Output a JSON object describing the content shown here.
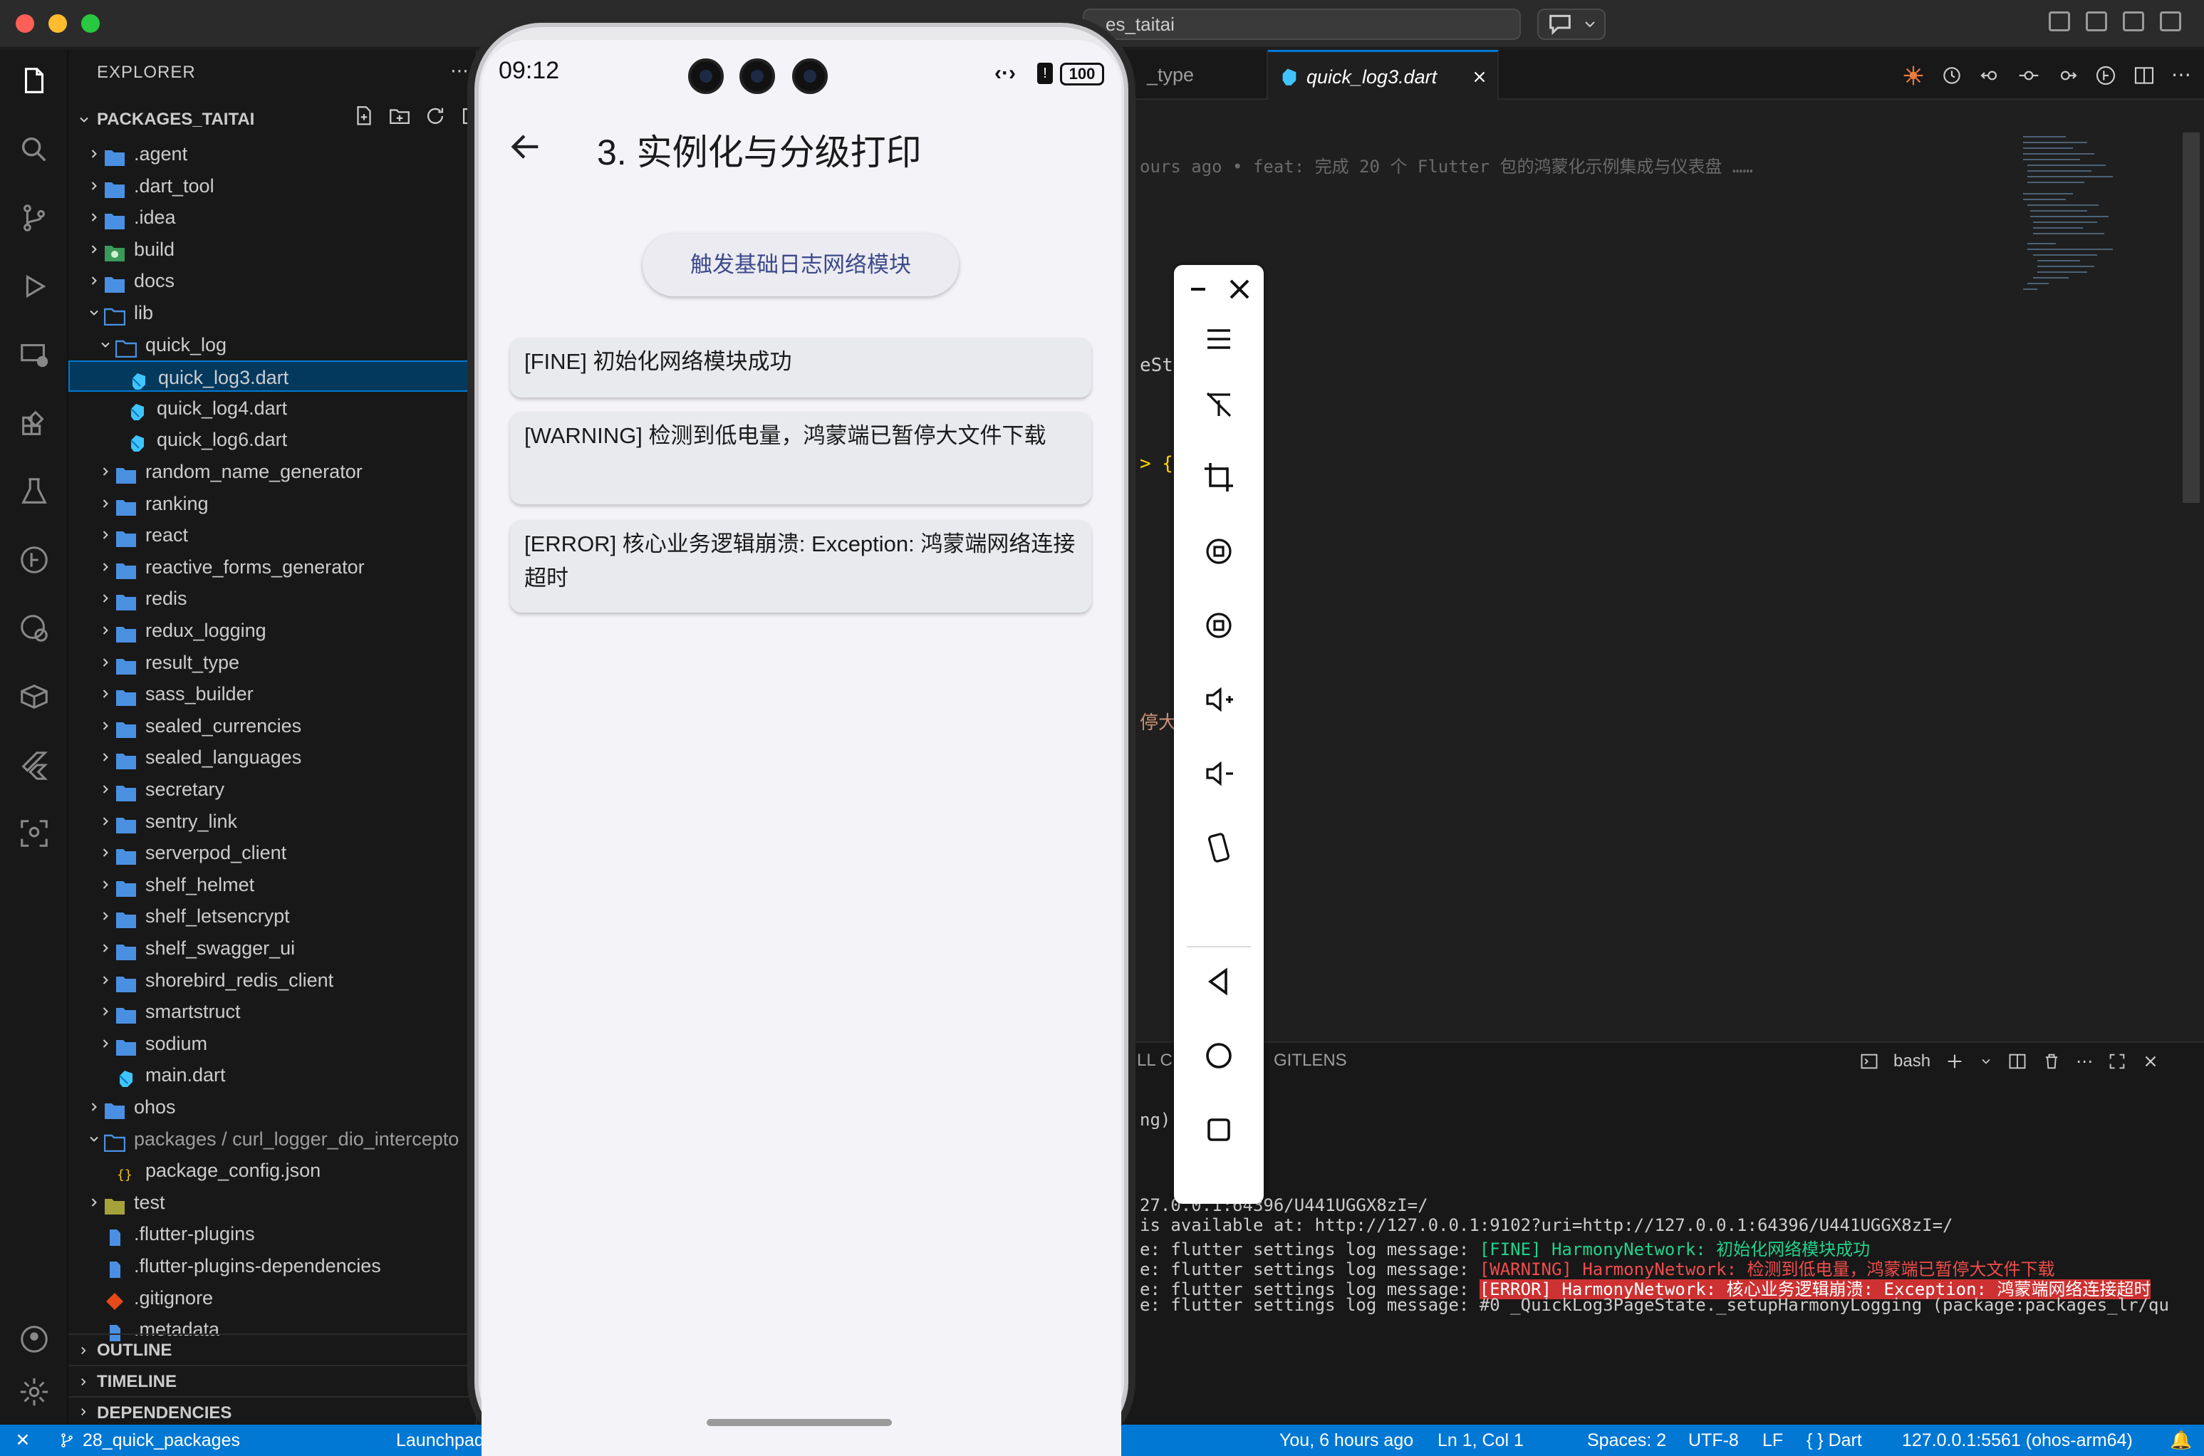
{
  "window": {
    "command_center_text": "packages_taitai",
    "command_center_visible": "es_taitai"
  },
  "explorer": {
    "header": "EXPLORER",
    "section": "PACKAGES_TAITAI",
    "items": [
      {
        "label": ".agent",
        "icon": "folder-icon"
      },
      {
        "label": ".dart_tool",
        "icon": "folder-icon"
      },
      {
        "label": ".idea",
        "icon": "folder-icon"
      },
      {
        "label": "build",
        "icon": "folder-build-icon"
      },
      {
        "label": "docs",
        "icon": "folder-icon"
      },
      {
        "label": "lib",
        "icon": "folder-open-icon"
      },
      {
        "label": "quick_log",
        "icon": "folder-open-icon"
      },
      {
        "label": "quick_log3.dart",
        "icon": "dart-file-icon"
      },
      {
        "label": "quick_log4.dart",
        "icon": "dart-file-icon"
      },
      {
        "label": "quick_log6.dart",
        "icon": "dart-file-icon"
      },
      {
        "label": "random_name_generator",
        "icon": "folder-icon"
      },
      {
        "label": "ranking",
        "icon": "folder-icon"
      },
      {
        "label": "react",
        "icon": "folder-icon"
      },
      {
        "label": "reactive_forms_generator",
        "icon": "folder-icon"
      },
      {
        "label": "redis",
        "icon": "folder-icon"
      },
      {
        "label": "redux_logging",
        "icon": "folder-icon"
      },
      {
        "label": "result_type",
        "icon": "folder-icon"
      },
      {
        "label": "sass_builder",
        "icon": "folder-icon"
      },
      {
        "label": "sealed_currencies",
        "icon": "folder-icon"
      },
      {
        "label": "sealed_languages",
        "icon": "folder-icon"
      },
      {
        "label": "secretary",
        "icon": "folder-icon"
      },
      {
        "label": "sentry_link",
        "icon": "folder-icon"
      },
      {
        "label": "serverpod_client",
        "icon": "folder-icon"
      },
      {
        "label": "shelf_helmet",
        "icon": "folder-icon"
      },
      {
        "label": "shelf_letsencrypt",
        "icon": "folder-icon"
      },
      {
        "label": "shelf_swagger_ui",
        "icon": "folder-icon"
      },
      {
        "label": "shorebird_redis_client",
        "icon": "folder-icon"
      },
      {
        "label": "smartstruct",
        "icon": "folder-icon"
      },
      {
        "label": "sodium",
        "icon": "folder-icon"
      },
      {
        "label": "main.dart",
        "icon": "dart-file-icon"
      },
      {
        "label": "ohos",
        "icon": "folder-icon"
      },
      {
        "label": "packages / curl_logger_dio_intercepto",
        "icon": "folder-open-icon"
      },
      {
        "label": "package_config.json",
        "icon": "json-file-icon"
      },
      {
        "label": "test",
        "icon": "folder-test-icon"
      },
      {
        "label": ".flutter-plugins",
        "icon": "file-icon"
      },
      {
        "label": ".flutter-plugins-dependencies",
        "icon": "file-icon"
      },
      {
        "label": ".gitignore",
        "icon": "git-file-icon"
      },
      {
        "label": ".metadata",
        "icon": "file-icon"
      }
    ],
    "outline": "OUTLINE",
    "timeline": "TIMELINE",
    "dependencies": "DEPENDENCIES"
  },
  "editor": {
    "tab_inactive": "_type",
    "tab_active": "quick_log3.dart",
    "blame": "ours ago • feat: 完成 20 个 Flutter 包的鸿蒙化示例集成与仪表盘 ……",
    "code_fragment_1": "eSta",
    "code_fragment_2": "> {",
    "code_fragment_3": "停大"
  },
  "panel": {
    "tab_partial": "LL C",
    "tab_gitlens": "GITLENS",
    "shell": "bash",
    "lines": [
      {
        "text": "ng)."
      },
      {
        "text": "27.0.0.1:64396/U441UGGX8zI=/"
      },
      {
        "text": "is available at: http://127.0.0.1:9102?uri=http://127.0.0.1:64396/U441UGGX8zI=/"
      },
      {
        "prefix": "e: flutter settings log message: ",
        "text": "[FINE] HarmonyNetwork: 初始化网络模块成功",
        "color": "#23d18b"
      },
      {
        "prefix": "e: flutter settings log message: ",
        "text": "[WARNING] HarmonyNetwork: 检测到低电量，鸿蒙端已暂停大文件下载",
        "color": "#f14c4c"
      },
      {
        "prefix": "e: flutter settings log message: ",
        "text": "[ERROR] HarmonyNetwork: 核心业务逻辑崩溃: Exception: 鸿蒙端网络连接超时",
        "color": "#ffffff",
        "bg": "#cd3131"
      },
      {
        "prefix": "e: flutter settings log message: ",
        "text": "#0      _QuickLog3PageState._setupHarmonyLogging (package:packages_lr/qu"
      }
    ]
  },
  "statusbar": {
    "branch": "28_quick_packages",
    "launchpad": "Launchpad",
    "blame": "You, 6 hours ago",
    "position": "Ln 1, Col 1",
    "spaces": "Spaces: 2",
    "encoding": "UTF-8",
    "eol": "LF",
    "language": "{ } Dart",
    "device": "127.0.0.1:5561 (ohos-arm64)"
  },
  "phone": {
    "time": "09:12",
    "battery": "100",
    "title": "3. 实例化与分级打印",
    "trigger_button": "触发基础日志网络模块",
    "logs": [
      "[FINE] 初始化网络模块成功",
      "[WARNING] 检测到低电量，鸿蒙端已暂停大文件下载",
      "[ERROR] 核心业务逻辑崩溃: Exception: 鸿蒙端网络连接超时"
    ]
  },
  "emulator_toolbar": {
    "icons": [
      "minimize-icon",
      "close-icon",
      "menu-icon",
      "pin-icon",
      "crop-icon",
      "rotate-left-icon",
      "rotate-right-icon",
      "volume-up-icon",
      "volume-down-icon",
      "shake-icon",
      "back-icon",
      "home-icon",
      "recents-icon"
    ]
  },
  "colors": {
    "accent": "#0078d4",
    "fine": "#23d18b",
    "warning": "#f14c4c",
    "error_bg": "#cd3131"
  }
}
